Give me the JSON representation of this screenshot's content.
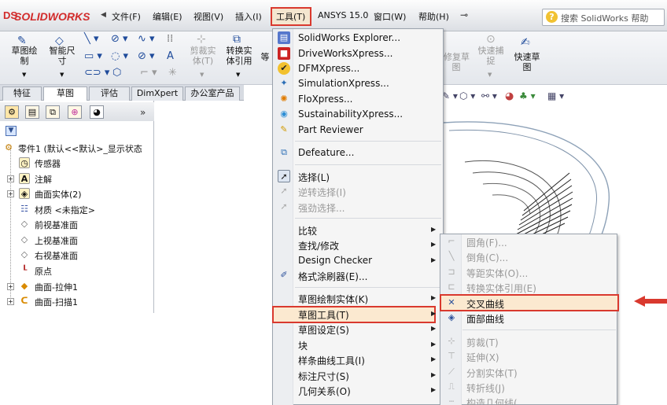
{
  "app": {
    "logo_text": "SOLIDWORKS",
    "logo_mark": "DS"
  },
  "menubar": {
    "items": [
      "文件(F)",
      "编辑(E)",
      "视图(V)",
      "插入(I)",
      "工具(T)",
      "ANSYS 15.0",
      "窗口(W)",
      "帮助(H)"
    ],
    "search_placeholder": "搜索 SolidWorks 帮助"
  },
  "ribbon": {
    "buttons": [
      {
        "label": "草图绘\n制",
        "enabled": true
      },
      {
        "label": "智能尺\n寸",
        "enabled": true
      },
      {
        "label": "剪裁实\n体(T)",
        "enabled": false
      },
      {
        "label": "转换实\n体引用",
        "enabled": true
      },
      {
        "label": "等",
        "enabled": true
      },
      {
        "label": "修复草\n图",
        "enabled": false
      },
      {
        "label": "快速捕\n捉",
        "enabled": false
      },
      {
        "label": "快速草\n图",
        "enabled": true
      }
    ]
  },
  "tabs": [
    "特征",
    "草图",
    "评估",
    "DimXpert",
    "办公室产品"
  ],
  "active_tab": "草图",
  "tree": {
    "root": "零件1 (默认<<默认>_显示状态",
    "items": [
      {
        "label": "传感器",
        "expandable": false,
        "icon": "sensor-icon"
      },
      {
        "label": "注解",
        "expandable": true,
        "icon": "annotation-icon"
      },
      {
        "label": "曲面实体(2)",
        "expandable": true,
        "icon": "surface-bodies-icon"
      },
      {
        "label": "材质 <未指定>",
        "expandable": false,
        "icon": "material-icon"
      },
      {
        "label": "前视基准面",
        "expandable": false,
        "icon": "plane-icon"
      },
      {
        "label": "上视基准面",
        "expandable": false,
        "icon": "plane-icon"
      },
      {
        "label": "右视基准面",
        "expandable": false,
        "icon": "plane-icon"
      },
      {
        "label": "原点",
        "expandable": false,
        "icon": "origin-icon"
      },
      {
        "label": "曲面-拉伸1",
        "expandable": true,
        "icon": "extrude-surface-icon"
      },
      {
        "label": "曲面-扫描1",
        "expandable": true,
        "icon": "sweep-surface-icon"
      }
    ]
  },
  "tools_menu": {
    "group1": [
      "SolidWorks Explorer...",
      "DriveWorksXpress...",
      "DFMXpress...",
      "SimulationXpress...",
      "FloXpress...",
      "SustainabilityXpress...",
      "Part Reviewer"
    ],
    "defeature": "Defeature...",
    "selection": [
      "选择(L)",
      "逆转选择(I)",
      "强劲选择..."
    ],
    "group3": [
      "比较",
      "查找/修改",
      "Design Checker",
      "格式涂刷器(E)..."
    ],
    "group4": [
      "草图绘制实体(K)",
      "草图工具(T)",
      "草图设定(S)",
      "块",
      "样条曲线工具(I)",
      "标注尺寸(S)",
      "几何关系(O)"
    ]
  },
  "sketch_tools_submenu": {
    "items": [
      {
        "label": "圆角(F)...",
        "enabled": false
      },
      {
        "label": "倒角(C)...",
        "enabled": false
      },
      {
        "label": "等距实体(O)...",
        "enabled": false
      },
      {
        "label": "转换实体引用(E)",
        "enabled": false
      },
      {
        "label": "交叉曲线",
        "enabled": true
      },
      {
        "label": "面部曲线",
        "enabled": true
      },
      {
        "label": "剪裁(T)",
        "enabled": false
      },
      {
        "label": "延伸(X)",
        "enabled": false
      },
      {
        "label": "分割实体(T)",
        "enabled": false
      },
      {
        "label": "转折线(J)",
        "enabled": false
      },
      {
        "label": "构造几何线(...",
        "enabled": false
      }
    ]
  },
  "colors": {
    "highlight_border": "#d9392e",
    "brand_red": "#d22b2b"
  }
}
